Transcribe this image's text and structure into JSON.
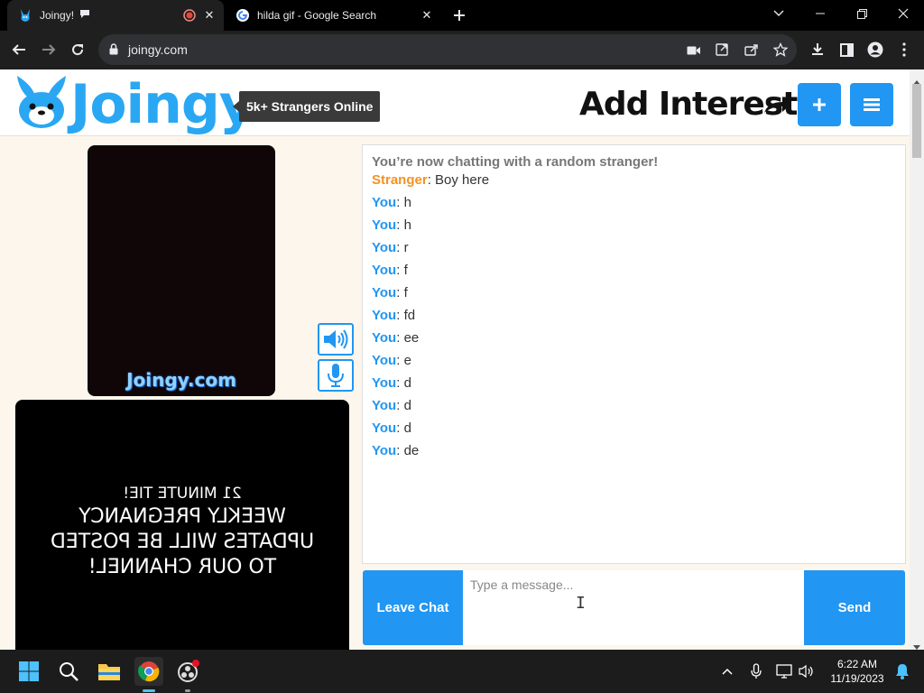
{
  "browser": {
    "tabs": [
      {
        "title": "Joingy!",
        "active": true
      },
      {
        "title": "hilda gif - Google Search",
        "active": false
      }
    ],
    "url": "joingy.com"
  },
  "site": {
    "logo": "Joingy",
    "online_count": "5k+ Strangers Online",
    "add_interests": "Add Interests",
    "video_watermark": "Joingy.com",
    "self_video_text": [
      "21 MINUTE TIE!",
      "WEEKLY PREGNANCY",
      "UPDATES WILL BE POSTED",
      "TO OUR CHANNEL!"
    ]
  },
  "chat": {
    "system_message": "You’re now chatting with a random stranger!",
    "messages": [
      {
        "from": "Stranger",
        "text": "Boy here"
      },
      {
        "from": "You",
        "text": "h"
      },
      {
        "from": "You",
        "text": "h"
      },
      {
        "from": "You",
        "text": "r"
      },
      {
        "from": "You",
        "text": "f"
      },
      {
        "from": "You",
        "text": "f"
      },
      {
        "from": "You",
        "text": "fd"
      },
      {
        "from": "You",
        "text": "ee"
      },
      {
        "from": "You",
        "text": "e"
      },
      {
        "from": "You",
        "text": "d"
      },
      {
        "from": "You",
        "text": "d"
      },
      {
        "from": "You",
        "text": "d"
      },
      {
        "from": "You",
        "text": "de"
      }
    ],
    "input_placeholder": "Type a message...",
    "leave_label": "Leave Chat",
    "send_label": "Send"
  },
  "taskbar": {
    "time": "6:22 AM",
    "date": "11/19/2023"
  },
  "colors": {
    "accent": "#2196f3",
    "stranger": "#f39223",
    "page_bg": "#fdf6ec"
  }
}
